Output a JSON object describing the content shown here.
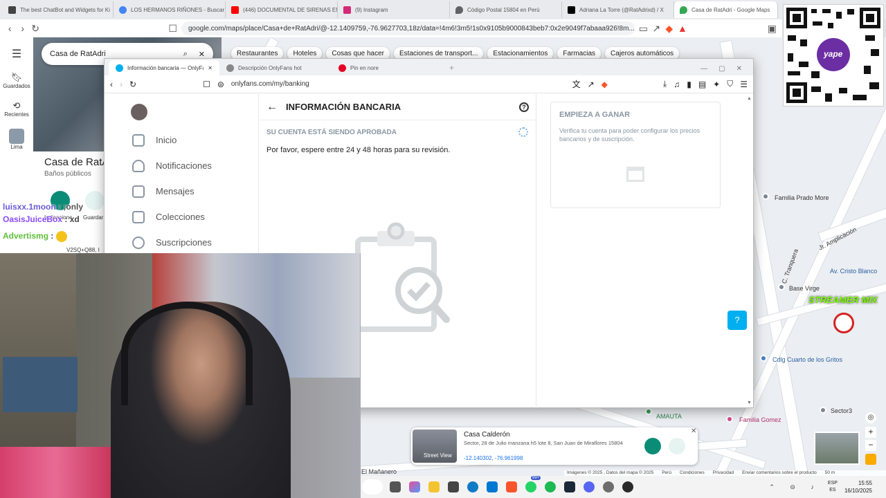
{
  "outer_browser": {
    "tabs": [
      {
        "label": "The best ChatBot and Widgets for Ki",
        "color": "#444"
      },
      {
        "label": "LOS HERMANOS RIÑONES - Buscar",
        "color": "#4285f4"
      },
      {
        "label": "(446) DOCUMENTAL DE SIRENAS EN",
        "color": "#ff0000"
      },
      {
        "label": "(9) Instagram",
        "color": "#d62976"
      },
      {
        "label": "Código Postal 15804 en Perú",
        "color": "#5f6368"
      },
      {
        "label": "Adriana La Torre (@RatAdrixd) / X",
        "color": "#000"
      },
      {
        "label": "Casa de RatAdri - Google Maps",
        "color": "#34a853"
      }
    ],
    "url": "google.com/maps/place/Casa+de+RatAdri/@-12.1409759,-76.9627703,18z/data=!4m6!3m5!1s0x9105b9000843beb7:0x2e9049f7abaaa926!8m..."
  },
  "maps": {
    "search_value": "Casa de RatAdri",
    "sidebar": [
      {
        "label": "Guardados"
      },
      {
        "label": "Recientes"
      },
      {
        "label": "Lima"
      }
    ],
    "chips": [
      "Restaurantes",
      "Hoteles",
      "Cosas que hacer",
      "Estaciones de transport...",
      "Estacionamientos",
      "Farmacias",
      "Cajeros automáticos"
    ],
    "place_title": "Casa de RatA",
    "place_subtitle": "Baños públicos",
    "action_directions": "Indicacione",
    "action_save": "Guardar",
    "plus_code": "V2SQ+Q88, I",
    "map_labels": [
      "Familia Prado More",
      "Av. Cristo Blanco",
      "Base Virge",
      "Cdlg Cuarto de los Gritos",
      "Sector3",
      "Familia Gomez",
      "AMAUTA",
      "El Mañanero",
      "C. Tranquera",
      "Jr. Amplicación"
    ],
    "card": {
      "name": "Casa Calderón",
      "address": "Sector, 28 de Julio manzana h5 lote 8, San Juan de Miraflores 15804",
      "coords": "-12.140302, -76.961998",
      "street_view": "Street View"
    },
    "footer": [
      "Imágenes © 2025 , Datos del mapa © 2025",
      "Perú",
      "Condiciones",
      "Privacidad",
      "Enviar comentarios sobre el producto",
      "50 m"
    ]
  },
  "inner_browser": {
    "tabs": [
      "Información bancaria — OnlyFans",
      "Descripción OnlyFans hot",
      "Pin en nore"
    ],
    "url": "onlyfans.com/my/banking"
  },
  "onlyfans": {
    "menu": [
      "Inicio",
      "Notificaciones",
      "Mensajes",
      "Colecciones",
      "Suscripciones"
    ],
    "header_title": "INFORMACIÓN BANCARIA",
    "status_title": "SU CUENTA ESTÁ SIENDO APROBADA",
    "status_text": "Por favor, espere entre 24 y 48 horas para su revisión.",
    "earn_title": "EMPIEZA A GANAR",
    "earn_text": "Verifica tu cuenta para poder configurar los precios bancarios y de suscripción."
  },
  "chat": [
    {
      "user": "luisxx.1moon",
      "msg": ": ;only",
      "color": "#6b5bd6"
    },
    {
      "user": "OasisJuiceBox",
      "msg": ": xd",
      "color": "#8a4bff"
    },
    {
      "user": "Advertismg",
      "msg": ":",
      "color": "#7cd957"
    }
  ],
  "overlays": {
    "streamer": "STREAMER MIX",
    "qr_brand": "yape"
  },
  "taskbar": {
    "lang": "ESP",
    "lang2": "ES",
    "time": "15:55",
    "date": "16/10/2025",
    "badge": "99+"
  }
}
